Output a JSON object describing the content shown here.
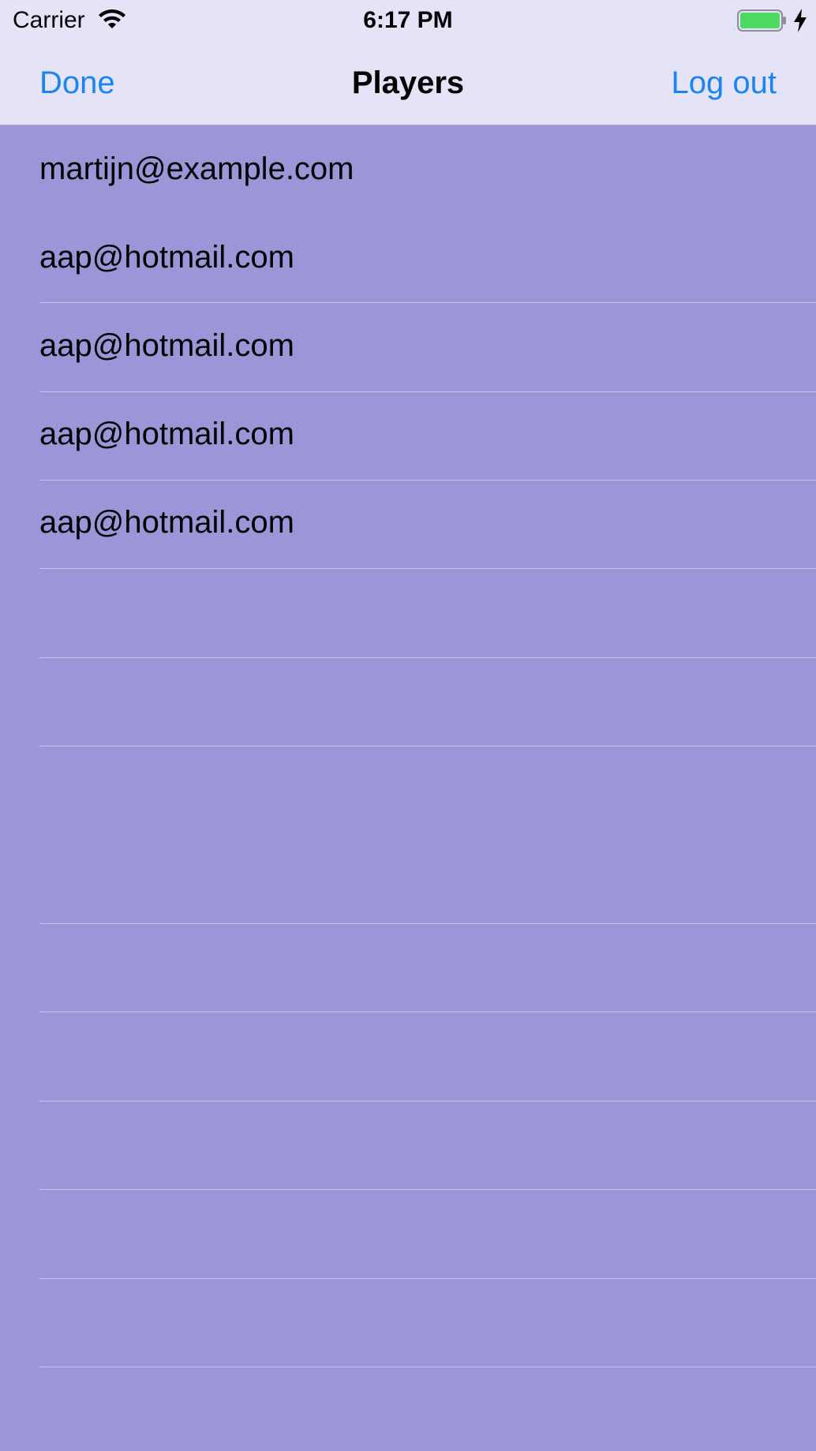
{
  "status_bar": {
    "carrier": "Carrier",
    "time": "6:17 PM",
    "icons": [
      "wifi-icon",
      "battery-icon",
      "charging-bolt-icon"
    ],
    "battery_color": "#4cd964"
  },
  "nav": {
    "left_label": "Done",
    "title": "Players",
    "right_label": "Log out",
    "accent_color": "#1a84f5"
  },
  "players": [
    "martijn@example.com",
    "aap@hotmail.com",
    "aap@hotmail.com",
    "aap@hotmail.com",
    "aap@hotmail.com"
  ],
  "colors": {
    "background": "#9b96d8",
    "bar_background": "#e5e3f8"
  }
}
